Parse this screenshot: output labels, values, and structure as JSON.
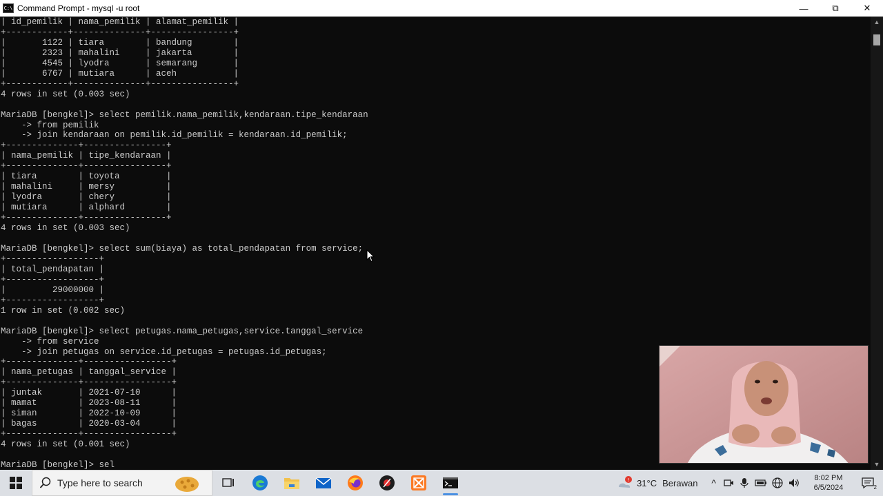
{
  "window": {
    "title": "Command Prompt - mysql  -u root",
    "icon_text": "C:\\",
    "minimize_glyph": "—",
    "restore_glyph": "⧉",
    "close_glyph": "✕"
  },
  "console": {
    "lines": [
      "| id_pemilik | nama_pemilik | alamat_pemilik |",
      "+------------+--------------+----------------+",
      "|       1122 | tiara        | bandung        |",
      "|       2323 | mahalini     | jakarta        |",
      "|       4545 | lyodra       | semarang       |",
      "|       6767 | mutiara      | aceh           |",
      "+------------+--------------+----------------+",
      "4 rows in set (0.003 sec)",
      "",
      "MariaDB [bengkel]> select pemilik.nama_pemilik,kendaraan.tipe_kendaraan",
      "    -> from pemilik",
      "    -> join kendaraan on pemilik.id_pemilik = kendaraan.id_pemilik;",
      "+--------------+----------------+",
      "| nama_pemilik | tipe_kendaraan |",
      "+--------------+----------------+",
      "| tiara        | toyota         |",
      "| mahalini     | mersy          |",
      "| lyodra       | chery          |",
      "| mutiara      | alphard        |",
      "+--------------+----------------+",
      "4 rows in set (0.003 sec)",
      "",
      "MariaDB [bengkel]> select sum(biaya) as total_pendapatan from service;",
      "+------------------+",
      "| total_pendapatan |",
      "+------------------+",
      "|         29000000 |",
      "+------------------+",
      "1 row in set (0.002 sec)",
      "",
      "MariaDB [bengkel]> select petugas.nama_petugas,service.tanggal_service",
      "    -> from service",
      "    -> join petugas on service.id_petugas = petugas.id_petugas;",
      "+--------------+-----------------+",
      "| nama_petugas | tanggal_service |",
      "+--------------+-----------------+",
      "| juntak       | 2021-07-10      |",
      "| mamat        | 2023-08-11      |",
      "| siman        | 2022-10-09      |",
      "| bagas        | 2020-03-04      |",
      "+--------------+-----------------+",
      "4 rows in set (0.001 sec)",
      "",
      "MariaDB [bengkel]> sel"
    ]
  },
  "scrollbar": {
    "up": "▲",
    "down": "▼"
  },
  "taskbar": {
    "search_placeholder": "Type here to search",
    "apps": [
      "task-view",
      "edge",
      "file-explorer",
      "mail",
      "firefox",
      "media-app",
      "xampp",
      "command-prompt"
    ],
    "weather_temp": "31°C",
    "weather_desc": "Berawan",
    "time": "8:02 PM",
    "date": "6/5/2024",
    "notification_count": "2",
    "tray_chevron": "^"
  },
  "colors": {
    "console_bg": "#0c0c0c",
    "console_text": "#cccccc",
    "taskbar_bg": "#dcdfe4",
    "accent": "#4a90e2"
  }
}
